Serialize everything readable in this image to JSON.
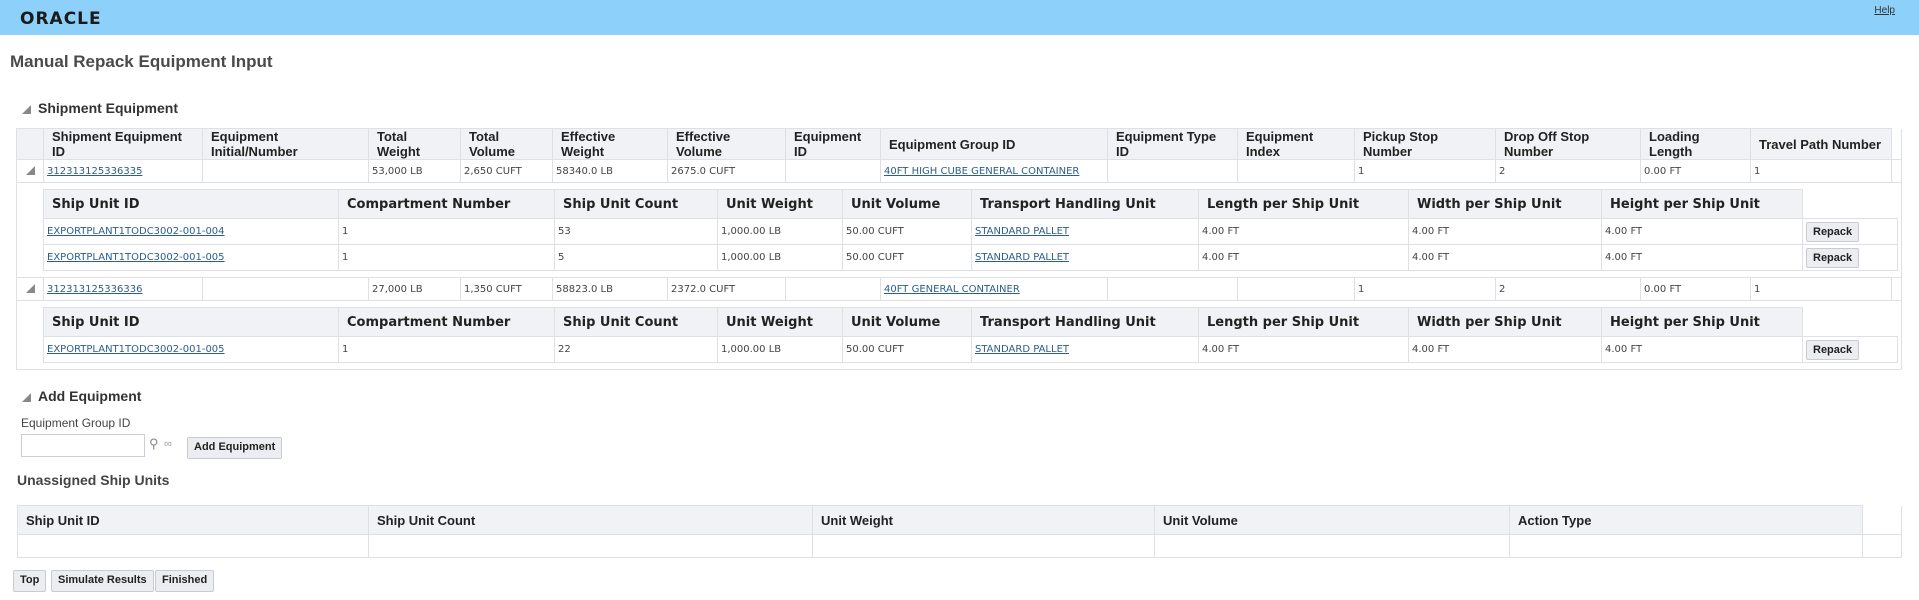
{
  "header": {
    "logo": "ORACLE",
    "help": "Help"
  },
  "page_title": "Manual Repack Equipment Input",
  "shipment_equipment": {
    "title": "Shipment Equipment",
    "columns": [
      "Shipment Equipment ID",
      "Equipment Initial/Number",
      "Total Weight",
      "Total Volume",
      "Effective Weight",
      "Effective Volume",
      "Equipment ID",
      "Equipment Group ID",
      "Equipment Type ID",
      "Equipment Index",
      "Pickup Stop Number",
      "Drop Off Stop Number",
      "Loading Length",
      "Travel Path Number"
    ],
    "unit_columns": [
      "Ship Unit ID",
      "Compartment Number",
      "Ship Unit Count",
      "Unit Weight",
      "Unit Volume",
      "Transport Handling Unit",
      "Length per Ship Unit",
      "Width per Ship Unit",
      "Height per Ship Unit"
    ],
    "repack_label": "Repack",
    "rows": [
      {
        "id": "312313125336335",
        "initial": "",
        "total_weight": "53,000 LB",
        "total_volume": "2,650 CUFT",
        "effective_weight": "58340.0 LB",
        "effective_volume": "2675.0 CUFT",
        "equipment_id": "",
        "group_id": "40FT HIGH CUBE GENERAL CONTAINER",
        "type_id": "",
        "index": "",
        "pickup": "1",
        "dropoff": "2",
        "loading_length": "0.00 FT",
        "travel_path": "1",
        "units": [
          {
            "id": "EXPORTPLANT1TODC3002-001-004",
            "compartment": "1",
            "count": "53",
            "weight": "1,000.00 LB",
            "volume": "50.00 CUFT",
            "thu": "STANDARD PALLET",
            "length": "4.00 FT",
            "width": "4.00 FT",
            "height": "4.00 FT"
          },
          {
            "id": "EXPORTPLANT1TODC3002-001-005",
            "compartment": "1",
            "count": "5",
            "weight": "1,000.00 LB",
            "volume": "50.00 CUFT",
            "thu": "STANDARD PALLET",
            "length": "4.00 FT",
            "width": "4.00 FT",
            "height": "4.00 FT"
          }
        ]
      },
      {
        "id": "312313125336336",
        "initial": "",
        "total_weight": "27,000 LB",
        "total_volume": "1,350 CUFT",
        "effective_weight": "58823.0 LB",
        "effective_volume": "2372.0 CUFT",
        "equipment_id": "",
        "group_id": "40FT GENERAL CONTAINER",
        "type_id": "",
        "index": "",
        "pickup": "1",
        "dropoff": "2",
        "loading_length": "0.00 FT",
        "travel_path": "1",
        "units": [
          {
            "id": "EXPORTPLANT1TODC3002-001-005",
            "compartment": "1",
            "count": "22",
            "weight": "1,000.00 LB",
            "volume": "50.00 CUFT",
            "thu": "STANDARD PALLET",
            "length": "4.00 FT",
            "width": "4.00 FT",
            "height": "4.00 FT"
          }
        ]
      }
    ]
  },
  "add_equipment": {
    "title": "Add Equipment",
    "field_label": "Equipment Group ID",
    "field_value": "",
    "button": "Add Equipment"
  },
  "unassigned": {
    "title": "Unassigned Ship Units",
    "columns": [
      "Ship Unit ID",
      "Ship Unit Count",
      "Unit Weight",
      "Unit Volume",
      "Action Type"
    ]
  },
  "footer": {
    "top": "Top",
    "simulate": "Simulate Results",
    "finished": "Finished"
  }
}
